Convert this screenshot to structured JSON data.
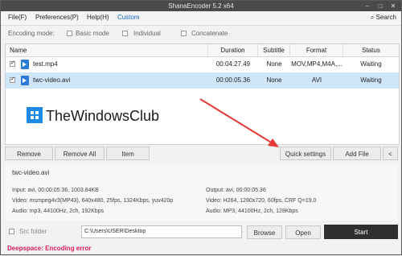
{
  "window": {
    "title": "ShanaEncoder 5.2 x64"
  },
  "menu": {
    "items": [
      "File(F)",
      "Preferences(P)",
      "Help(H)",
      "Custom"
    ],
    "search_label": "Search"
  },
  "encoding": {
    "label": "Encoding mode:",
    "basic": "Basic mode",
    "individual": "Individual",
    "concatenate": "Concatenate"
  },
  "table": {
    "headers": [
      "Name",
      "Duration",
      "Subtitle",
      "Format",
      "Status"
    ],
    "rows": [
      {
        "name": "test.mp4",
        "duration": "00:04:27.49",
        "subtitle": "None",
        "format": "MOV,MP4,M4A,...",
        "status": "Waiting"
      },
      {
        "name": "twc-video.avi",
        "duration": "00:00:05.36",
        "subtitle": "None",
        "format": "AVI",
        "status": "Waiting"
      }
    ]
  },
  "watermark": {
    "text": "TheWindowsClub"
  },
  "buttons": {
    "remove": "Remove",
    "remove_all": "Remove All",
    "item": "Item",
    "quick_settings": "Quick settings",
    "add_file": "Add File",
    "collapse": "<"
  },
  "info": {
    "title": "twc-video.avi",
    "input": "Input: avi, 00:00:05.36, 1003.84KB",
    "video_in": "Video: msmpeg4v3(MP43), 640x480, 25fps, 1324Kbps,  yuv420p",
    "audio_in": "Audio: mp3, 44100Hz, 2ch, 192Kbps",
    "output": "Output: avi, 00:00:05.36",
    "video_out": "Video: H264, 1280x720, 60fps, CRF Q=19.0",
    "audio_out": "Audio: MP3, 44100Hz, 2ch, 128Kbps"
  },
  "bottom": {
    "src_folder": "Src folder",
    "path": "C:\\Users\\USER\\Desktop",
    "browse": "Browse",
    "open": "Open",
    "start": "Start"
  },
  "status": {
    "text": "Deepspace: Encoding error"
  },
  "colors": {
    "titlebar": "#4a4a4a",
    "selection": "#cfe6fb",
    "start": "#2f2f2f",
    "status": "#d81b60",
    "arrow": "#e53935"
  }
}
